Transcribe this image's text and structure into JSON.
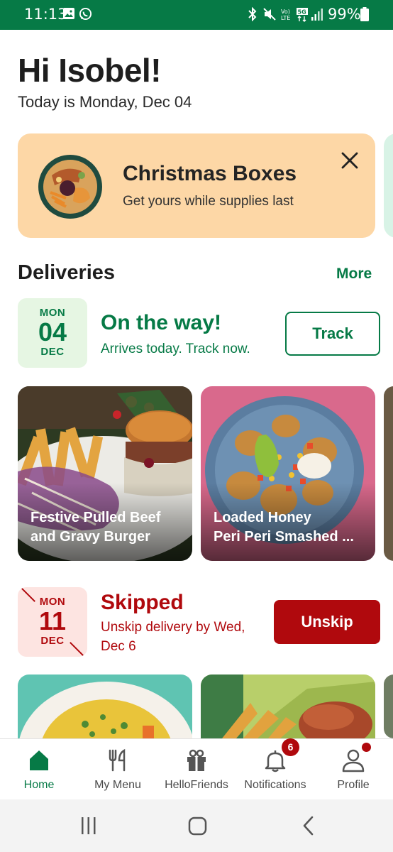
{
  "status_bar": {
    "time": "11:13",
    "battery": "99%",
    "icons": [
      "gallery-icon",
      "whatsapp-icon",
      "bluetooth-icon",
      "mute-icon",
      "volte-icon",
      "5g-icon",
      "signal-icon",
      "battery-icon"
    ]
  },
  "header": {
    "greeting": "Hi Isobel!",
    "date_line": "Today is Monday, Dec 04"
  },
  "promo": {
    "title": "Christmas Boxes",
    "subtitle": "Get yours while supplies last"
  },
  "deliveries": {
    "title": "Deliveries",
    "more_label": "More",
    "upcoming": {
      "weekday": "MON",
      "day": "04",
      "month": "DEC",
      "status": "On the way!",
      "detail": "Arrives today. Track now.",
      "action": "Track",
      "recipes": [
        {
          "line1": "Festive Pulled Beef",
          "line2": "and Gravy Burger"
        },
        {
          "line1": "Loaded Honey",
          "line2": "Peri Peri Smashed ..."
        }
      ]
    },
    "skipped": {
      "weekday": "MON",
      "day": "11",
      "month": "DEC",
      "status": "Skipped",
      "detail": "Unskip delivery by Wed, Dec 6",
      "action": "Unskip"
    }
  },
  "bottom_nav": {
    "items": [
      {
        "label": "Home",
        "icon": "home-icon",
        "active": true
      },
      {
        "label": "My Menu",
        "icon": "fork-knife-icon"
      },
      {
        "label": "HelloFriends",
        "icon": "gift-icon"
      },
      {
        "label": "Notifications",
        "icon": "bell-icon",
        "badge": "6"
      },
      {
        "label": "Profile",
        "icon": "person-icon"
      }
    ]
  },
  "colors": {
    "brand_green": "#067a46",
    "alert_red": "#b0090d",
    "promo_bg": "#fdd7a6"
  }
}
